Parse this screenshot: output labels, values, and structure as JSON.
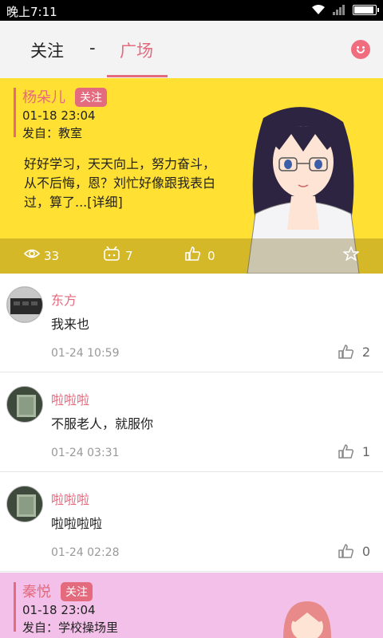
{
  "status": {
    "time": "晚上7:11"
  },
  "nav": {
    "tab_follow": "关注",
    "separator": "-",
    "tab_square": "广场"
  },
  "featured": [
    {
      "author": "杨朵儿",
      "follow_label": "关注",
      "date": "01-18 23:04",
      "place": "发自：教室",
      "text": "好好学习，天天向上，努力奋斗，从不后悔，恩？刘忙好像跟我表白过，算了...[详细]",
      "views": "33",
      "comments": "7",
      "likes": "0",
      "bg_color": "#ffe033"
    },
    {
      "author": "秦悦",
      "follow_label": "关注",
      "date": "01-18 23:04",
      "place": "发自：学校操场里",
      "bg_color": "#f2c0e8"
    }
  ],
  "comments": [
    {
      "name": "东方",
      "message": "我来也",
      "time": "01-24 10:59",
      "likes": "2"
    },
    {
      "name": "啦啦啦",
      "message": "不服老人，就服你",
      "time": "01-24 03:31",
      "likes": "1"
    },
    {
      "name": "啦啦啦",
      "message": "啦啦啦啦",
      "time": "01-24 02:28",
      "likes": "0"
    }
  ],
  "colors": {
    "accent": "#e46a7e"
  },
  "icons": [
    "wifi-icon",
    "signal-icon",
    "battery-icon",
    "smiley-icon",
    "eye-icon",
    "comment-icon",
    "thumbs-up-icon",
    "star-icon"
  ]
}
